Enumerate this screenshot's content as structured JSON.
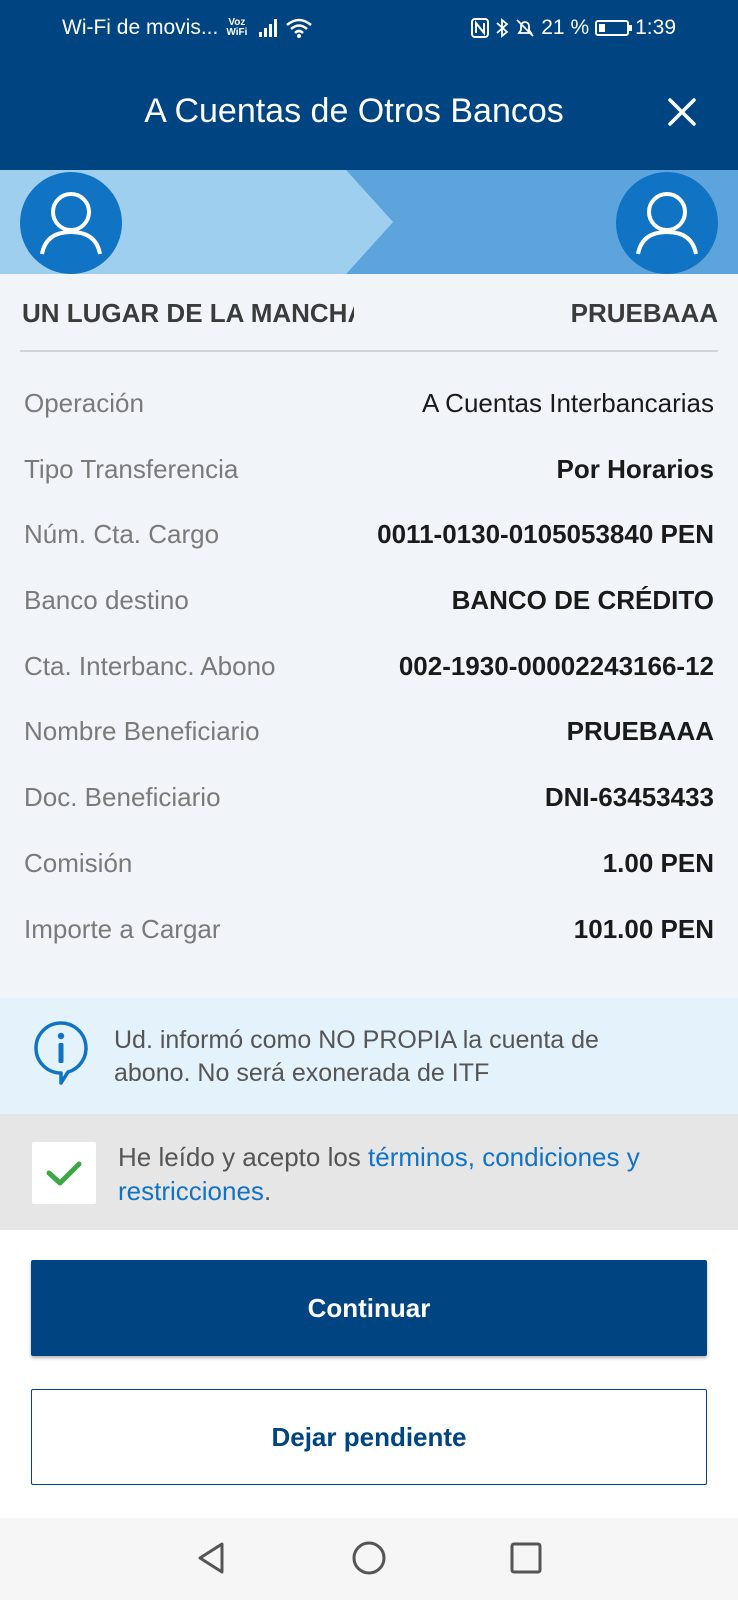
{
  "status_bar": {
    "carrier": "Wi-Fi de movis...",
    "voz_label": "Voz",
    "wifi_label": "WiFi",
    "battery": "21 %",
    "time": "1:39"
  },
  "header": {
    "title": "A Cuentas de Otros Bancos"
  },
  "transfer": {
    "from_name": "UN LUGAR DE LA MANCHA",
    "to_name": "PRUEBAAA"
  },
  "details": [
    {
      "label": "Operación",
      "value": "A Cuentas Interbancarias"
    },
    {
      "label": "Tipo Transferencia",
      "value": "Por Horarios"
    },
    {
      "label": "Núm. Cta. Cargo",
      "value": "0011-0130-0105053840 PEN"
    },
    {
      "label": "Banco destino",
      "value": "BANCO DE CRÉDITO"
    },
    {
      "label": "Cta. Interbanc. Abono",
      "value": "002-1930-00002243166-12"
    },
    {
      "label": "Nombre Beneficiario",
      "value": "PRUEBAAA"
    },
    {
      "label": "Doc. Beneficiario",
      "value": "DNI-63453433"
    },
    {
      "label": "Comisión",
      "value": "1.00 PEN"
    },
    {
      "label": "Importe a Cargar",
      "value": "101.00 PEN"
    }
  ],
  "info": {
    "message": "Ud. informó como NO PROPIA la cuenta de abono. No será exonerada de ITF"
  },
  "terms": {
    "checked": true,
    "text_before": "He leído y acepto los ",
    "link_text": "términos, condiciones y restricciones",
    "text_after": "."
  },
  "buttons": {
    "continue_label": "Continuar",
    "pending_label": "Dejar pendiente"
  },
  "colors": {
    "brand": "#004481",
    "accent": "#1173c4",
    "check": "#3aa845"
  },
  "icons": {
    "close": "close-icon",
    "avatar": "user-icon",
    "info": "info-icon",
    "check": "check-icon",
    "nav_back": "back-triangle-icon",
    "nav_home": "home-circle-icon",
    "nav_recent": "recents-square-icon"
  }
}
